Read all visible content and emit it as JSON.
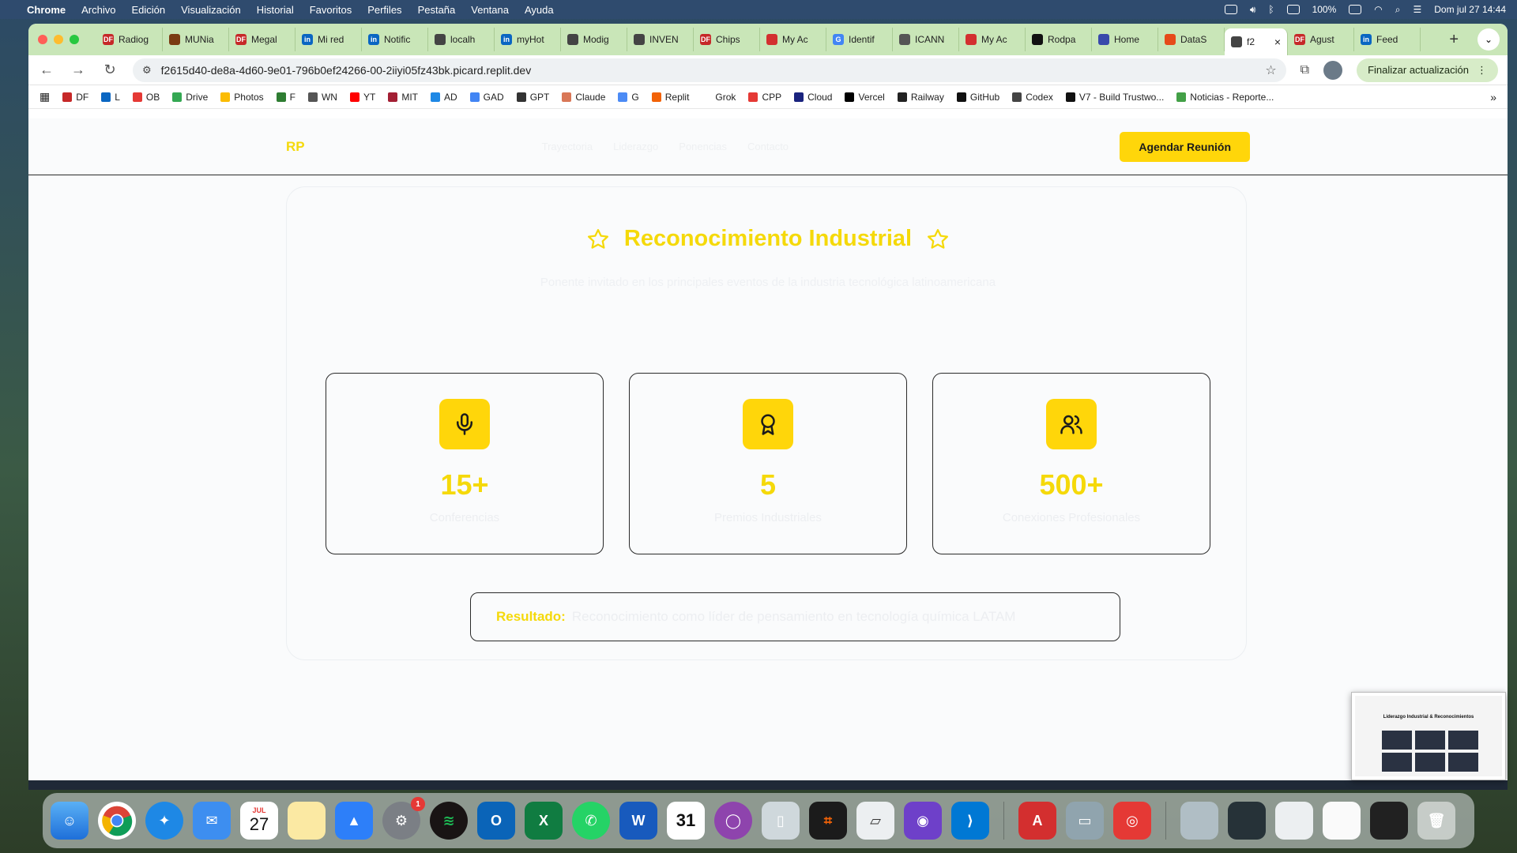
{
  "menubar": {
    "items": [
      "Chrome",
      "Archivo",
      "Edición",
      "Visualización",
      "Historial",
      "Favoritos",
      "Perfiles",
      "Pestaña",
      "Ventana",
      "Ayuda"
    ],
    "battery": "100%",
    "datetime": "Dom jul 27  14:44"
  },
  "tabs": [
    {
      "label": "Radiog",
      "color": "#c62828",
      "icon_text": "DF"
    },
    {
      "label": "MUNia",
      "color": "#7a3b12",
      "icon_text": ""
    },
    {
      "label": "Megal",
      "color": "#c62828",
      "icon_text": "DF"
    },
    {
      "label": "Mi red",
      "color": "#0a66c2",
      "icon_text": "in"
    },
    {
      "label": "Notific",
      "color": "#0a66c2",
      "icon_text": "in"
    },
    {
      "label": "localh",
      "color": "#444444",
      "icon_text": ""
    },
    {
      "label": "myHot",
      "color": "#0a66c2",
      "icon_text": "in"
    },
    {
      "label": "Modig",
      "color": "#444444",
      "icon_text": ""
    },
    {
      "label": "INVEN",
      "color": "#444444",
      "icon_text": ""
    },
    {
      "label": "Chips",
      "color": "#c62828",
      "icon_text": "DF"
    },
    {
      "label": "My Ac",
      "color": "#d32f2f",
      "icon_text": ""
    },
    {
      "label": "Identif",
      "color": "#4285f4",
      "icon_text": "G"
    },
    {
      "label": "ICANN",
      "color": "#555555",
      "icon_text": ""
    },
    {
      "label": "My Ac",
      "color": "#d32f2f",
      "icon_text": ""
    },
    {
      "label": "Rodpa",
      "color": "#111111",
      "icon_text": ""
    },
    {
      "label": "Home",
      "color": "#3949ab",
      "icon_text": ""
    },
    {
      "label": "DataS",
      "color": "#e64a19",
      "icon_text": ""
    },
    {
      "label": "f2",
      "color": "#444444",
      "icon_text": "",
      "active": true
    },
    {
      "label": "Agust",
      "color": "#c62828",
      "icon_text": "DF"
    },
    {
      "label": "Feed",
      "color": "#0a66c2",
      "icon_text": "in"
    }
  ],
  "toolbar": {
    "url": "f2615d40-de8a-4d60-9e01-796b0ef24266-00-2iiyi05fz43bk.picard.replit.dev",
    "update_label": "Finalizar actualización"
  },
  "bookmarks": [
    {
      "label": "DF",
      "color": "#c62828"
    },
    {
      "label": "L",
      "color": "#0a66c2"
    },
    {
      "label": "OB",
      "color": "#e53935"
    },
    {
      "label": "Drive",
      "color": "#34a853"
    },
    {
      "label": "Photos",
      "color": "#fbbc04"
    },
    {
      "label": "F",
      "color": "#2e7d32"
    },
    {
      "label": "WN",
      "color": "#555555"
    },
    {
      "label": "YT",
      "color": "#ff0000"
    },
    {
      "label": "MIT",
      "color": "#a31f34"
    },
    {
      "label": "AD",
      "color": "#1e88e5"
    },
    {
      "label": "GAD",
      "color": "#4285f4"
    },
    {
      "label": "GPT",
      "color": "#333333"
    },
    {
      "label": "Claude",
      "color": "#d97757"
    },
    {
      "label": "G",
      "color": "#4c8bf5"
    },
    {
      "label": "Replit",
      "color": "#f26207"
    },
    {
      "label": "Grok",
      "color": "#ffffff"
    },
    {
      "label": "CPP",
      "color": "#e53935"
    },
    {
      "label": "Cloud",
      "color": "#1a237e"
    },
    {
      "label": "Vercel",
      "color": "#000000"
    },
    {
      "label": "Railway",
      "color": "#222222"
    },
    {
      "label": "GitHub",
      "color": "#111111"
    },
    {
      "label": "Codex",
      "color": "#444444"
    },
    {
      "label": "V7 - Build Trustwo...",
      "color": "#111111"
    },
    {
      "label": "Noticias - Reporte...",
      "color": "#43a047"
    }
  ],
  "site": {
    "logo": "RP",
    "nav": [
      "Trayectoria",
      "Liderazgo",
      "Ponencias",
      "Contacto"
    ],
    "cta": "Agendar Reunión"
  },
  "section": {
    "title": "Reconocimiento Industrial",
    "subtitle": "Ponente invitado en los principales eventos de la industria tecnológica latinoamericana"
  },
  "cards": [
    {
      "icon": "microphone-icon",
      "value": "15+",
      "label": "Conferencias"
    },
    {
      "icon": "award-icon",
      "value": "5",
      "label": "Premios Industriales"
    },
    {
      "icon": "users-icon",
      "value": "500+",
      "label": "Conexiones Profesionales"
    }
  ],
  "result": {
    "label": "Resultado:",
    "text": "Reconocimiento como líder de pensamiento en tecnología química LATAM"
  },
  "thumbnail": {
    "title": "Liderazgo Industrial & Reconocimientos"
  },
  "dock": {
    "calendar_month": "JUL",
    "calendar_day": "27",
    "settings_badge": "1",
    "calendar2_day": "31"
  },
  "colors": {
    "accent": "#ffd60a",
    "accent_text": "#f5d90a",
    "tabbar": "#c9e6b8"
  }
}
